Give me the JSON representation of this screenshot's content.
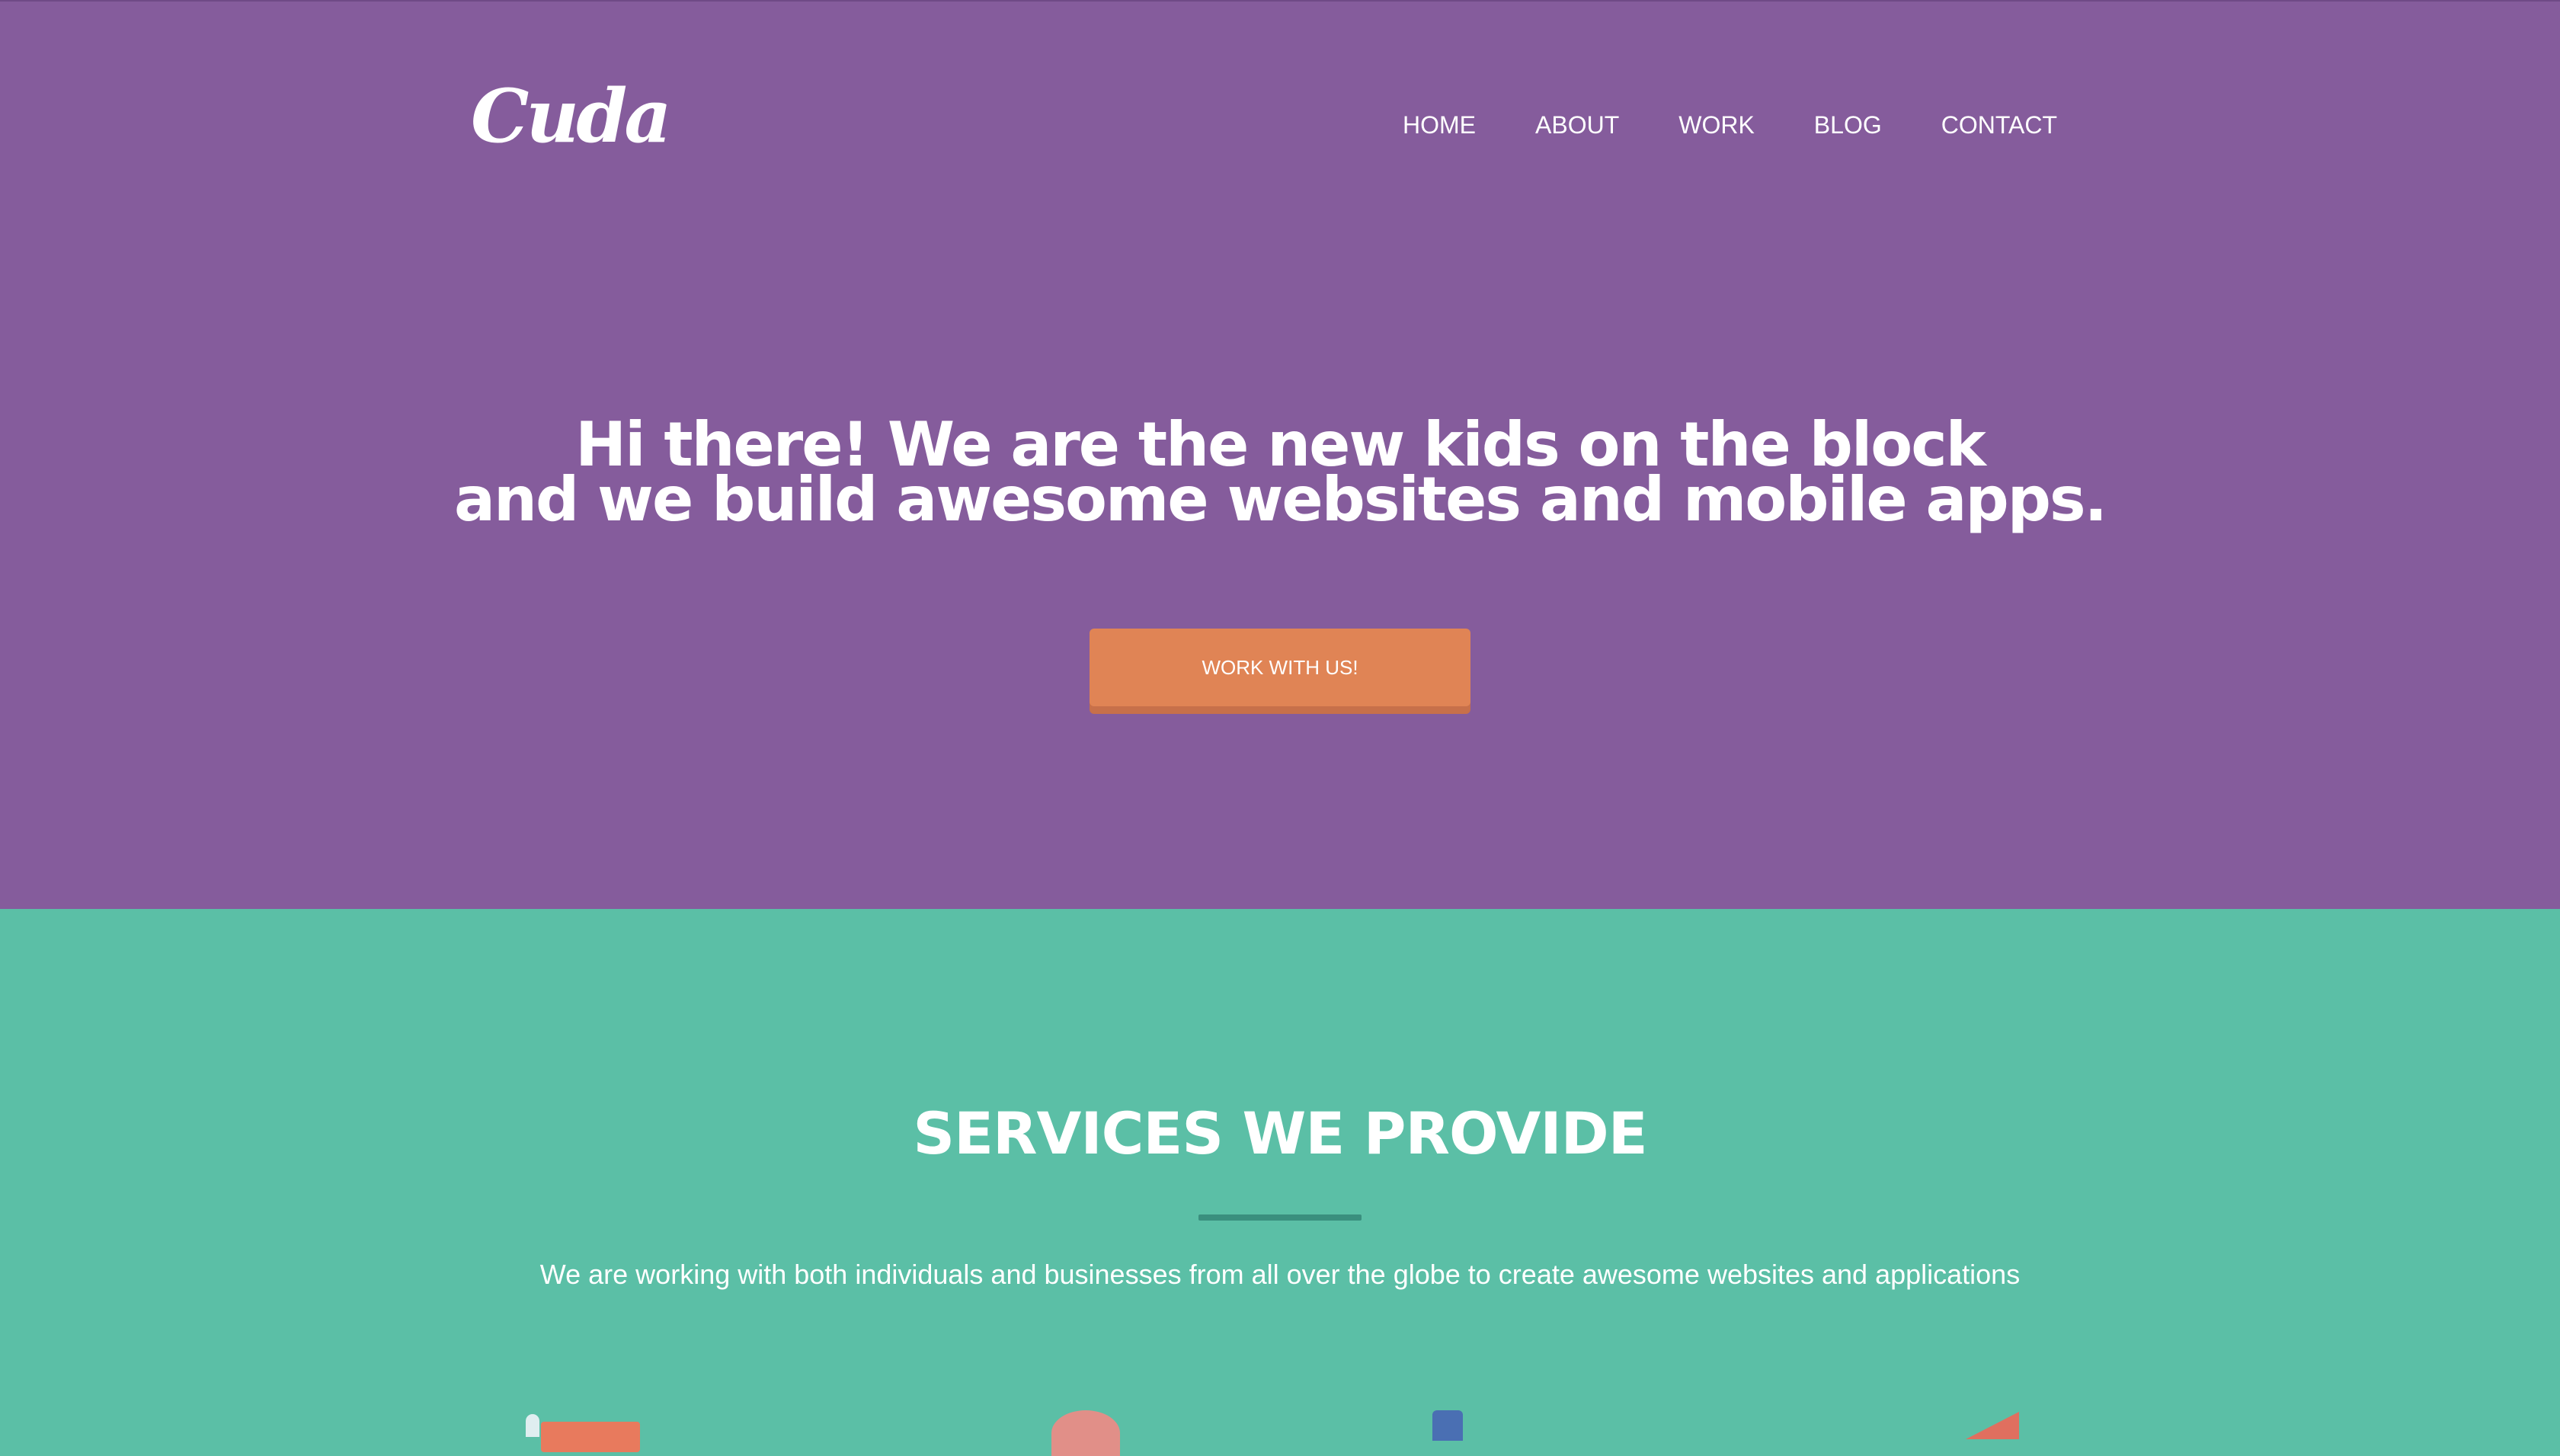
{
  "header": {
    "logo_text": "Cuda",
    "nav": [
      {
        "label": "HOME"
      },
      {
        "label": "ABOUT"
      },
      {
        "label": "WORK"
      },
      {
        "label": "BLOG"
      },
      {
        "label": "CONTACT"
      }
    ]
  },
  "hero": {
    "headline_line1": "Hi there! We are the new kids on the block",
    "headline_line2": "and we build awesome websites and mobile apps.",
    "cta_label": "WORK WITH US!"
  },
  "services": {
    "title": "SERVICES WE PROVIDE",
    "description": "We are working with both individuals and businesses from all over the globe to create awesome websites and applications",
    "icons": [
      "browser-icon",
      "mobile-icon",
      "chart-icon",
      "rocket-icon"
    ]
  },
  "colors": {
    "hero_bg": "#855c9c",
    "services_bg": "#5bbfa6",
    "cta_bg": "#e08455",
    "divider": "#3a8f7e",
    "text": "#ffffff"
  }
}
